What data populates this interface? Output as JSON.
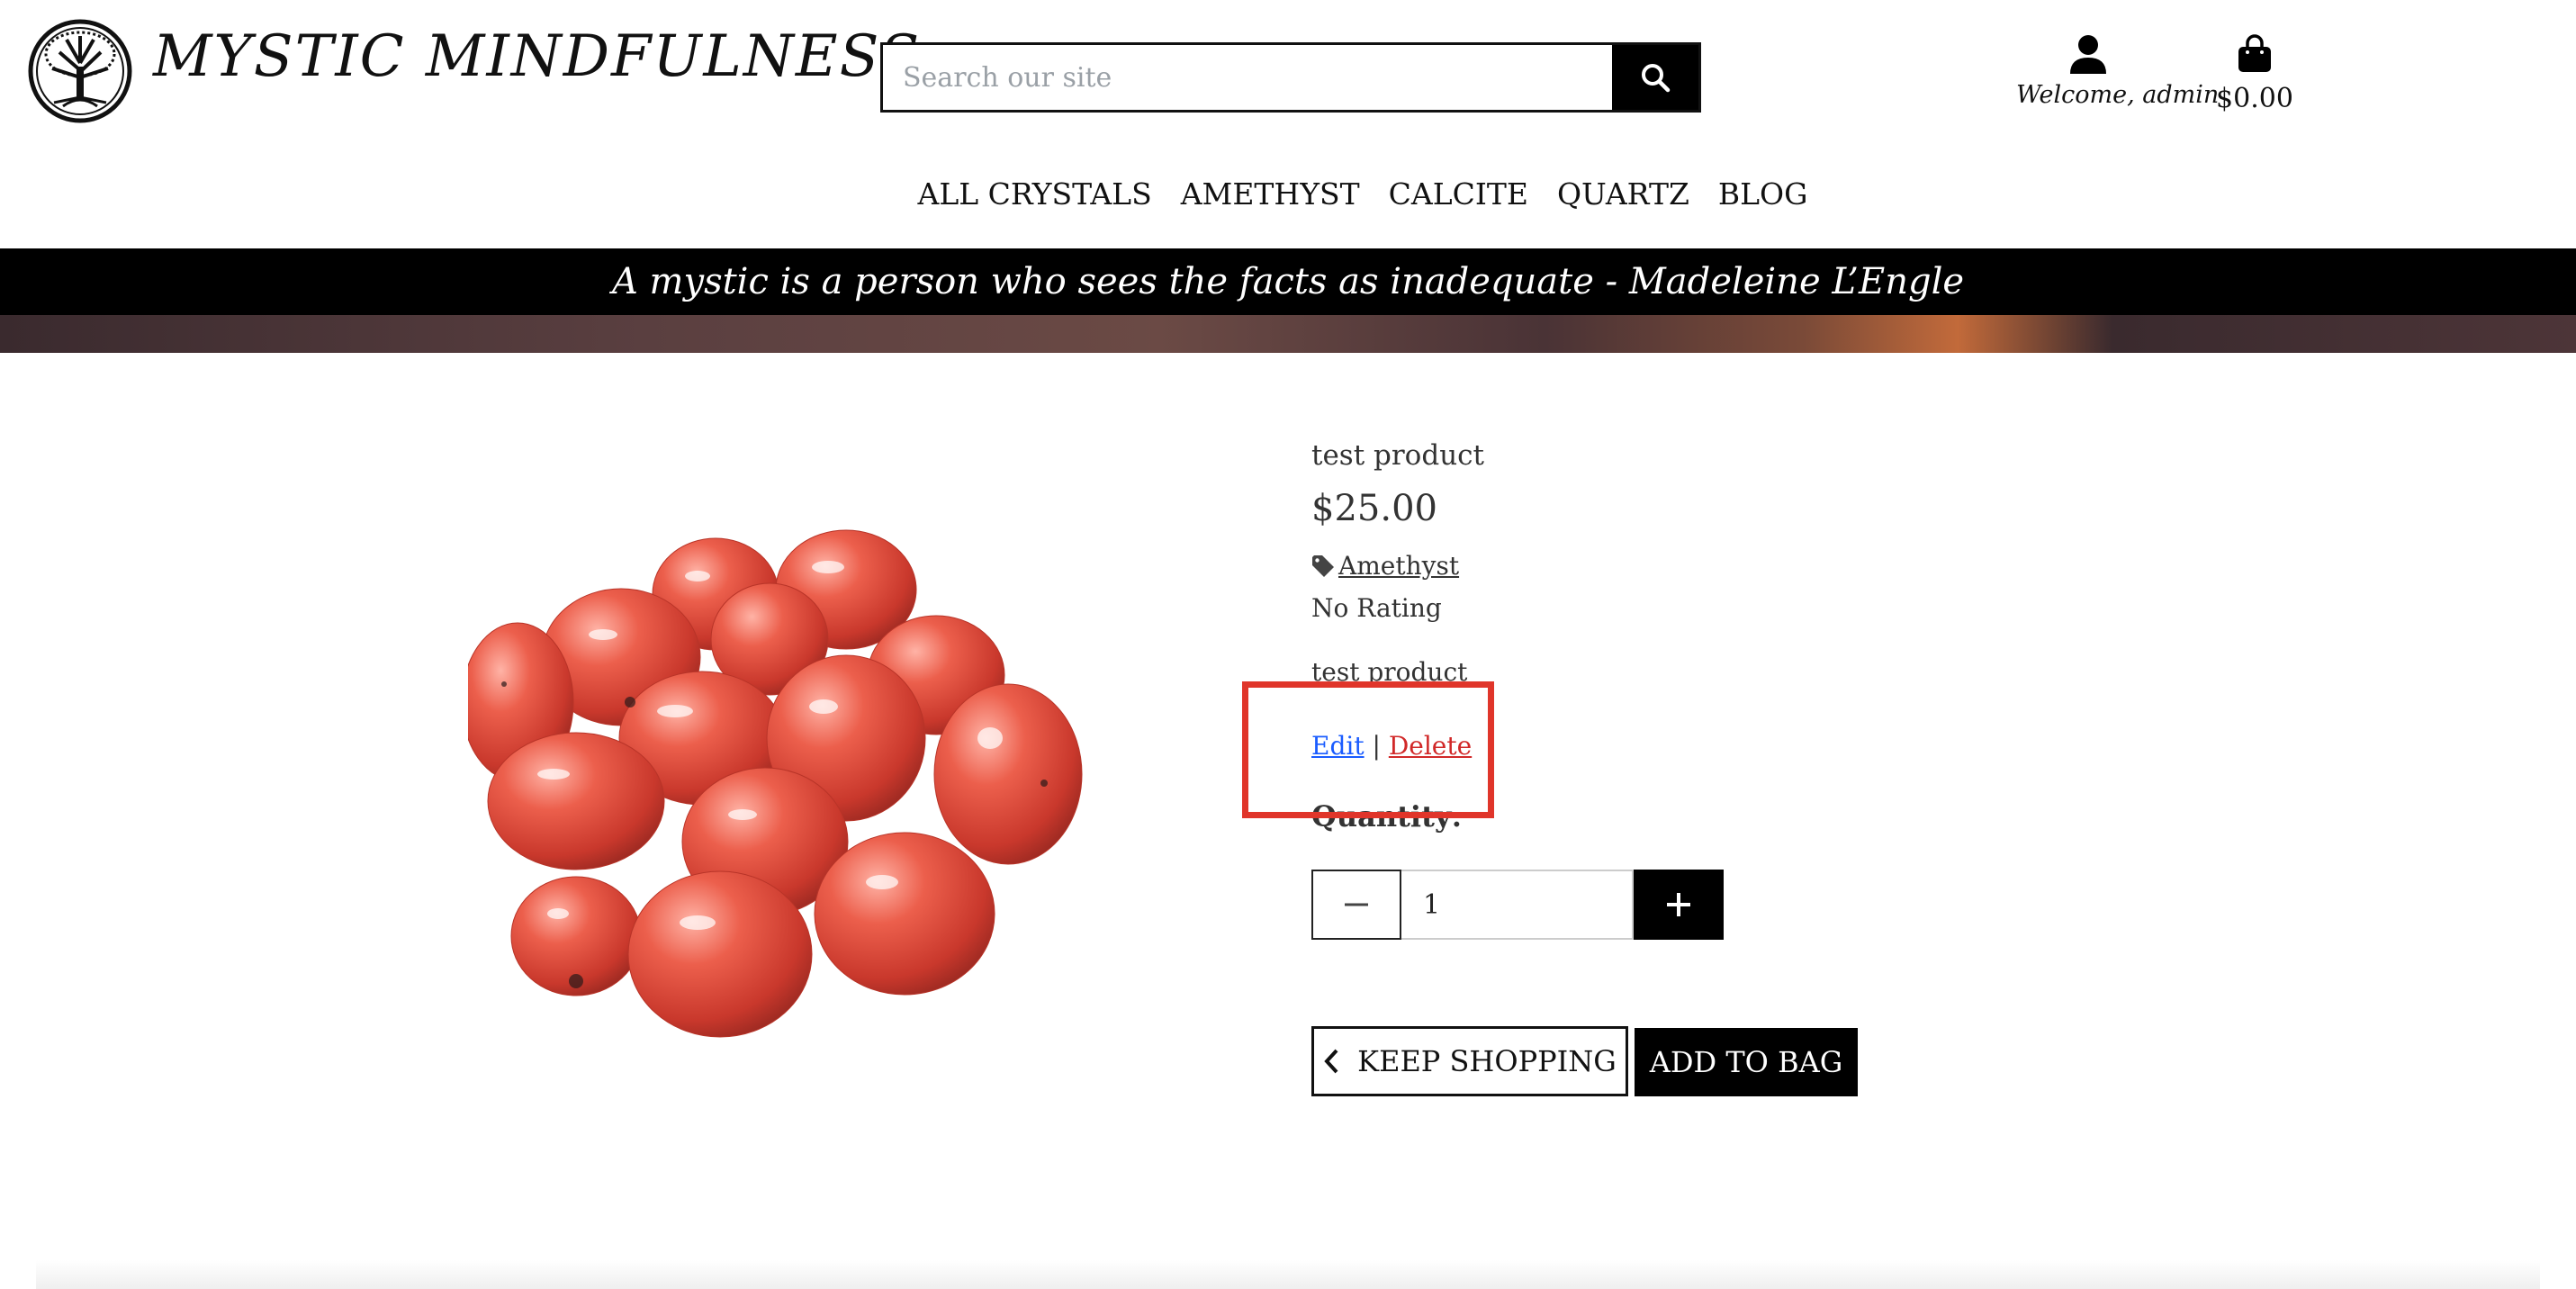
{
  "header": {
    "brand": "MYSTIC MINDFULNESS",
    "search_placeholder": "Search our site",
    "account_label": "Welcome, admin",
    "bag_total": "$0.00",
    "icons": {
      "logo": "tree-of-life-icon",
      "search": "search-icon",
      "account": "user-icon",
      "bag": "shopping-bag-icon"
    }
  },
  "nav": {
    "items": [
      "ALL CRYSTALS",
      "AMETHYST",
      "CALCITE",
      "QUARTZ",
      "BLOG"
    ]
  },
  "banner": {
    "quote": "A mystic is a person who sees the facts as inadequate - Madeleine L’Engle"
  },
  "product": {
    "name": "test product",
    "price": "$25.00",
    "category": "Amethyst",
    "rating": "No Rating",
    "description": "test product",
    "image_subject": "red tumbled crystal stones",
    "admin": {
      "edit": "Edit",
      "separator": "|",
      "delete": "Delete"
    },
    "quantity_label": "Quantity:",
    "quantity_value": "1",
    "keep_shopping": "KEEP SHOPPING",
    "add_to_bag": "ADD TO BAG"
  },
  "colors": {
    "highlight": "#e0352a",
    "edit_link": "#1a5cff",
    "delete_link": "#d12828",
    "stone": "#e0503f"
  }
}
